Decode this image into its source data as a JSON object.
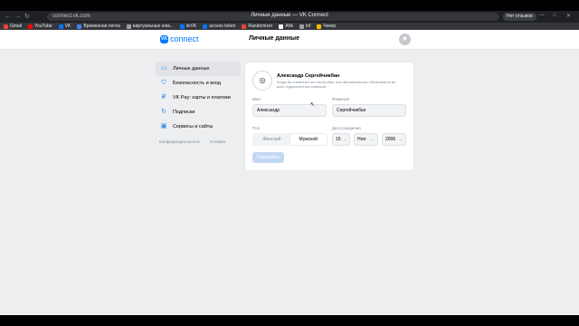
{
  "browser": {
    "tab_title": "Личные данные — VK Connect",
    "url": "connect.vk.com",
    "badge": "Нет отзывов",
    "bookmarks": [
      {
        "label": "Gmail",
        "color": "#ea4335"
      },
      {
        "label": "YouTube",
        "color": "#ff0000"
      },
      {
        "label": "VK",
        "color": "#0077ff"
      },
      {
        "label": "Временная почта",
        "color": "#4285f4"
      },
      {
        "label": "виртуальные ном...",
        "color": "#9aa0a6"
      },
      {
        "label": "livVK",
        "color": "#0077ff"
      },
      {
        "label": "access token",
        "color": "#0077ff"
      },
      {
        "label": "Randomizer",
        "color": "#e8453c"
      },
      {
        "label": "Ahk",
        "color": "#ffffff"
      },
      {
        "label": "inf",
        "color": "#9aa0a6"
      },
      {
        "label": "Чекер",
        "color": "#fbbc04"
      }
    ]
  },
  "header": {
    "logo_mark": "VK",
    "logo_text": "connect",
    "title": "Личные данные"
  },
  "sidebar": {
    "items": [
      {
        "label": "Личные данные",
        "icon": "person-card-icon",
        "glyph": "▭",
        "active": true
      },
      {
        "label": "Безопасность и вход",
        "icon": "shield-icon",
        "glyph": "⛉",
        "active": false
      },
      {
        "label": "VK Pay: карты и платежи",
        "icon": "vkpay-icon",
        "glyph": "₽",
        "active": false
      },
      {
        "label": "Подписки",
        "icon": "subscription-icon",
        "glyph": "↻",
        "active": false
      },
      {
        "label": "Сервисы и сайты",
        "icon": "services-icon",
        "glyph": "▣",
        "active": false
      }
    ],
    "footer_links": [
      "Конфиденциальность",
      "Условия"
    ]
  },
  "profile": {
    "name": "Александр Сергейчикбан",
    "hint": "Когда Вы измените эти настройки, они автоматически обновляются во всех подключённых сервисах",
    "first_name_label": "Имя",
    "first_name": "Александр",
    "last_name_label": "Фамилия",
    "last_name": "Сергейчикбан",
    "gender_label": "Пол",
    "gender_options": [
      "Женский",
      "Мужской"
    ],
    "gender_selected": "Мужской",
    "birth_label": "Дата рождения",
    "birth_day": "15",
    "birth_month": "Ноя",
    "birth_year": "2006",
    "save_label": "Сохранить"
  }
}
